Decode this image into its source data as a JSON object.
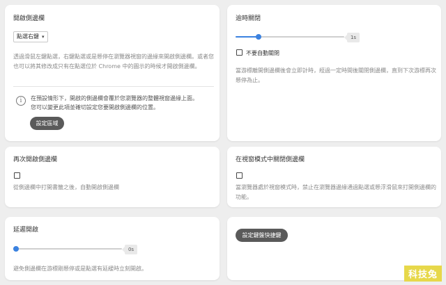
{
  "open_sidebar": {
    "title": "開啟側邊欄",
    "select_value": "點選右鍵",
    "description": "透過滑鼠左鍵點選，右鍵點選或是懸停在瀏覽器視窗的邊緣來開啟側邊欄。或者您也可以將其修改成只有在點選位於 Chrome 中的圖示的時候才開啟側邊欄。",
    "info_line1": "在預設情形下，開啟的側邊欄會覆於您瀏覽器的整體視窗邊緣上面。",
    "info_line2": "您可以變更此項並確切設定您要開啟側邊欄的位置。",
    "button_label": "設定區域"
  },
  "auto_close": {
    "title": "逾時關閉",
    "slider_value": "1s",
    "slider_level": 0.22,
    "checkbox_label": "不要自動關閉",
    "checkbox_checked": false,
    "description": "當游標離開側邊欄後會立即計時，經過一定時間後關閉側邊欄，直到下次游標再次懸停為止。"
  },
  "reopen_sidebar": {
    "title": "再次開啟側邊欄",
    "checkbox_checked": false,
    "description": "從側邊欄中打開書籤之後，自動開啟側邊欄"
  },
  "close_in_window_mode": {
    "title": "在視窗模式中關閉側邊欄",
    "checkbox_checked": false,
    "description": "當瀏覽器處於視窗模式時，禁止在瀏覽器邊緣通過點選或懸浮滑鼠來打開側邊欄的功能。"
  },
  "delay_open": {
    "title": "延遲開啟",
    "slider_value": "0s",
    "slider_level": 0,
    "description": "避免側邊欄在游標剛懸停或是點選有延緩時立刻開啟。"
  },
  "shortcuts": {
    "button_label": "設定鍵盤快捷鍵"
  },
  "watermark": {
    "text": "科技兔"
  },
  "colors": {
    "accent": "#3b82e0",
    "button_bg": "#5a5a5a",
    "page_bg": "#eeeeee",
    "watermark_bg": "#e7d84a"
  }
}
